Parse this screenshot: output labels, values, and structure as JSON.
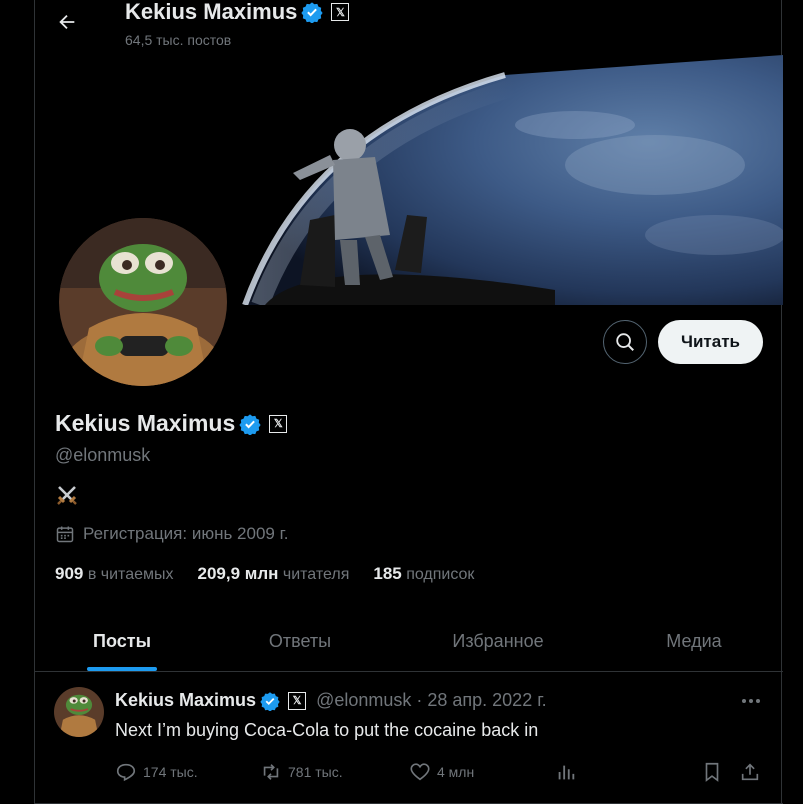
{
  "header": {
    "name": "Kekius Maximus",
    "posts_count": "64,5 тыс. постов",
    "x_badge": "𝕏"
  },
  "profile": {
    "name": "Kekius Maximus",
    "handle": "@elonmusk",
    "bio_emoji": "⚔️",
    "joined": "Регистрация: июнь 2009 г.",
    "x_badge": "𝕏",
    "follow_label": "Читать",
    "stats": {
      "following_value": "909",
      "following_label": "в читаемых",
      "followers_value": "209,9 млн",
      "followers_label": "читателя",
      "subs_value": "185",
      "subs_label": "подписок"
    }
  },
  "tabs": [
    {
      "label": "Посты",
      "active": true
    },
    {
      "label": "Ответы"
    },
    {
      "label": "Избранное"
    },
    {
      "label": "Медиа"
    }
  ],
  "post": {
    "name": "Kekius Maximus",
    "x_badge": "𝕏",
    "meta": "@elonmusk · 28 апр. 2022 г.",
    "text": "Next I’m buying Coca-Cola to put the cocaine back in",
    "replies": "174 тыс.",
    "reposts": "781 тыс.",
    "likes": "4 млн"
  },
  "colors": {
    "accent": "#1d9bf0",
    "background": "#000000",
    "secondary_text": "#71767b",
    "verified": "#1d9bf0"
  }
}
